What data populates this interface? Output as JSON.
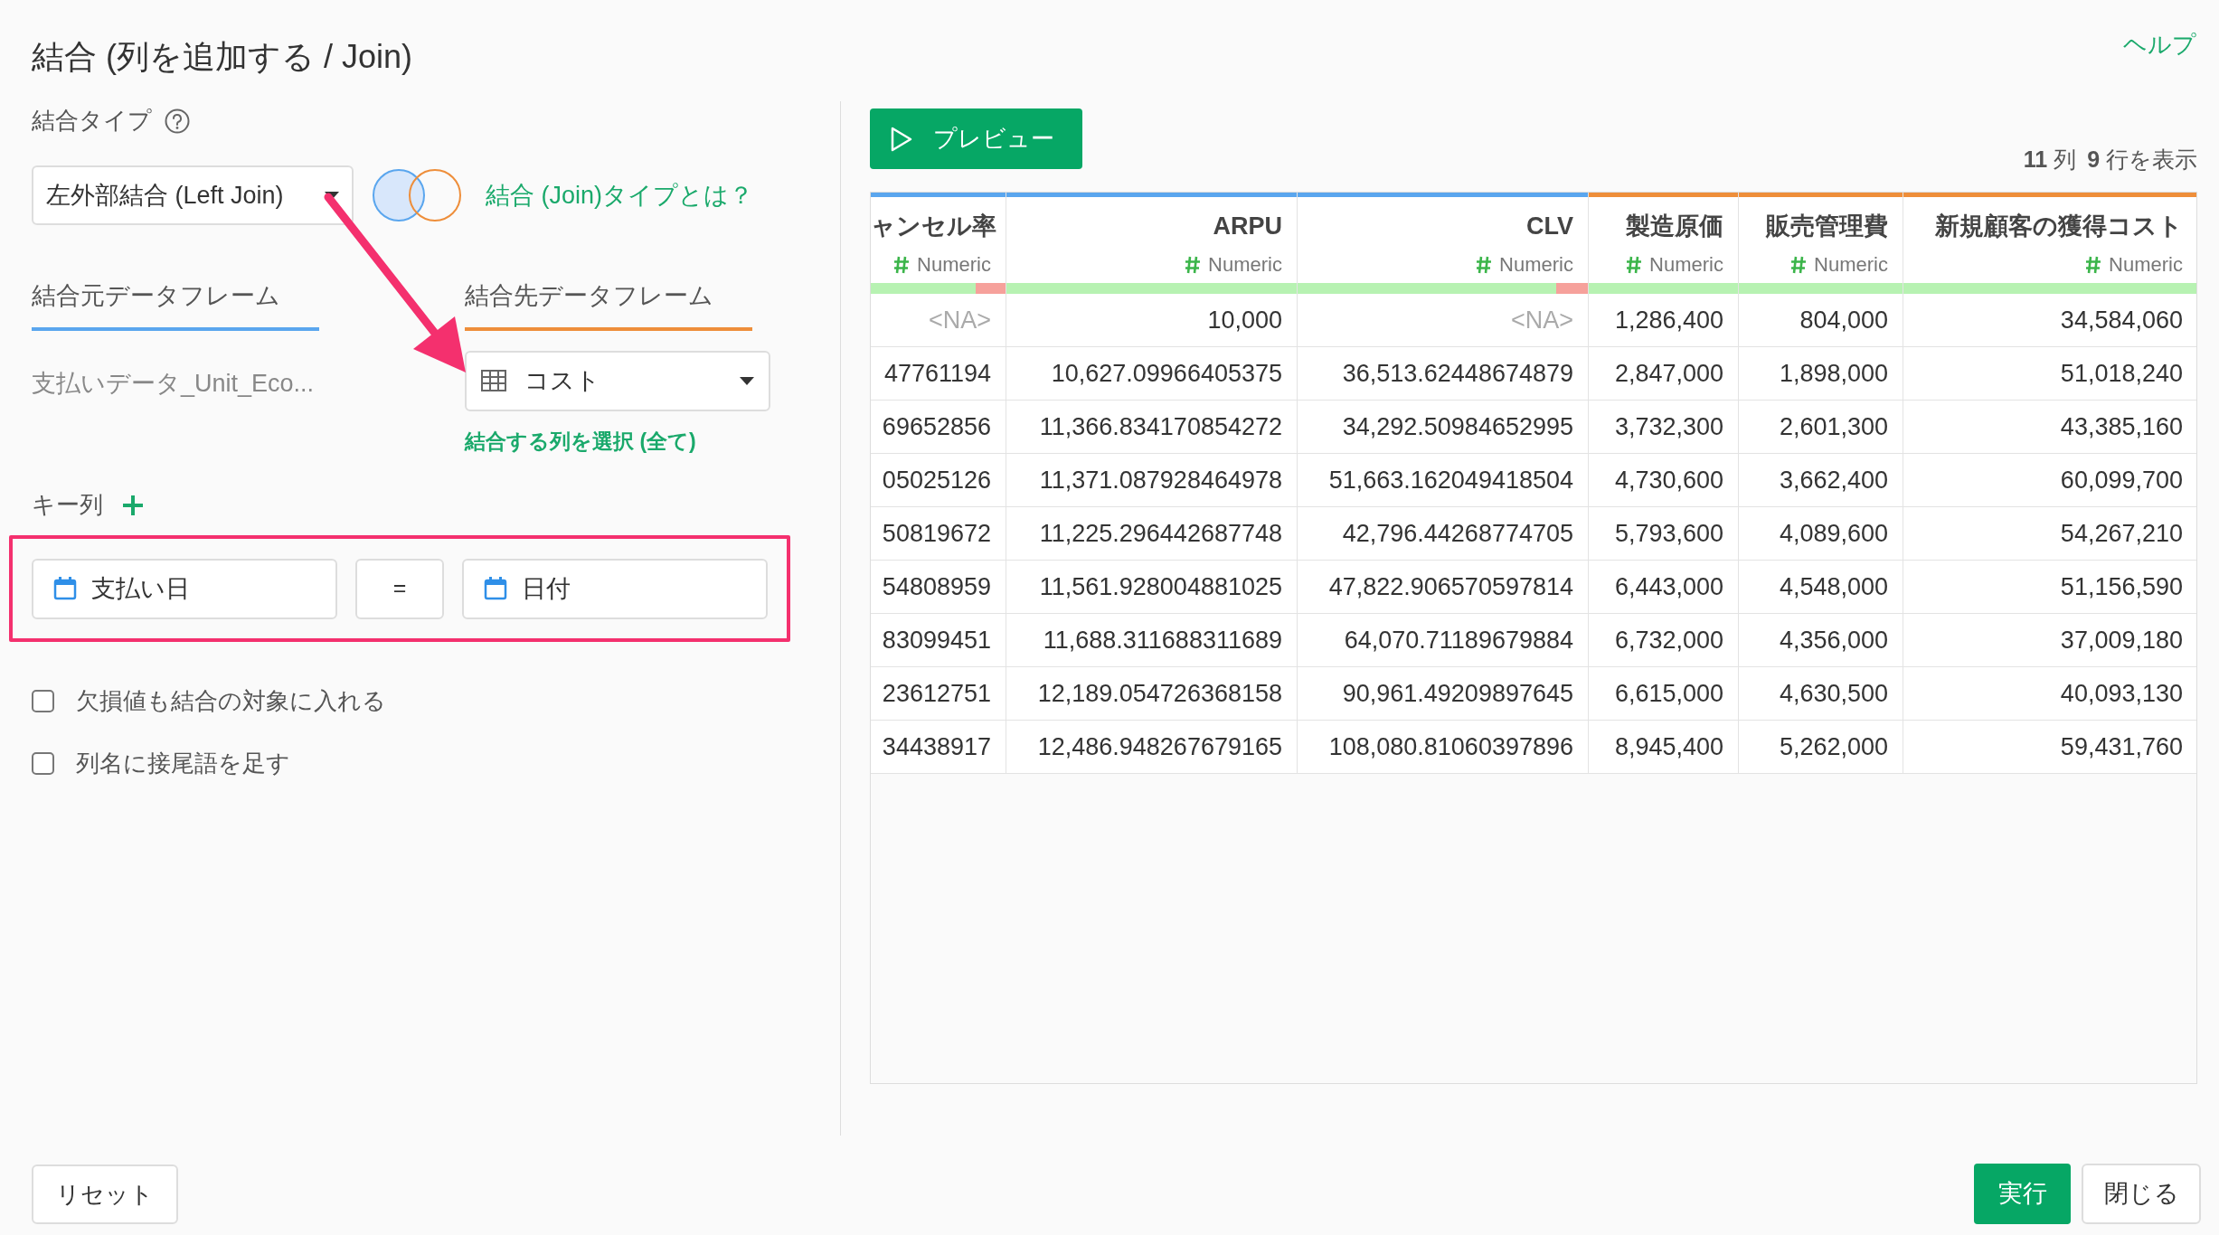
{
  "title": "結合 (列を追加する / Join)",
  "help_link": "ヘルプ",
  "join_type": {
    "label": "結合タイプ",
    "select_value": "左外部結合 (Left Join)",
    "info_link": "結合 (Join)タイプとは？"
  },
  "dataframes": [
    {
      "label": "結合元データフレーム",
      "color": "#5aa6ee",
      "value": "支払いデータ_Unit_Eco..."
    },
    {
      "label": "結合先データフレーム",
      "color": "#ee8e3a",
      "value": "コスト",
      "column_link": "結合する列を選択 (全て)"
    }
  ],
  "key_columns": {
    "label": "キー列",
    "left": "支払い日",
    "operator": "=",
    "right": "日付"
  },
  "options": [
    {
      "label": "欠損値も結合の対象に入れる",
      "checked": false
    },
    {
      "label": "列名に接尾語を足す",
      "checked": false
    }
  ],
  "preview_button": "プレビュー",
  "summary": {
    "columns": "11",
    "columns_unit": "列",
    "rows": "9",
    "rows_unit": "行を表示"
  },
  "table": {
    "columns": [
      {
        "name": "ャンセル率",
        "type": "Numeric",
        "color": "#5aa6ee",
        "level": 0.78
      },
      {
        "name": "ARPU",
        "type": "Numeric",
        "color": "#5aa6ee",
        "level": 1
      },
      {
        "name": "CLV",
        "type": "Numeric",
        "color": "#5aa6ee",
        "level": 0.89
      },
      {
        "name": "製造原価",
        "type": "Numeric",
        "color": "#ee8e3a",
        "level": 1
      },
      {
        "name": "販売管理費",
        "type": "Numeric",
        "color": "#ee8e3a",
        "level": 1
      },
      {
        "name": "新規顧客の獲得コスト",
        "type": "Numeric",
        "color": "#ee8e3a",
        "level": 1
      }
    ],
    "rows": [
      [
        {
          "value": "<NA>",
          "missing": true
        },
        "10,000",
        {
          "value": "<NA>",
          "missing": true
        },
        "1,286,400",
        "804,000",
        "34,584,060"
      ],
      [
        "47761194",
        "10,627.09966405375",
        "36,513.62448674879",
        "2,847,000",
        "1,898,000",
        "51,018,240"
      ],
      [
        "69652856",
        "11,366.834170854272",
        "34,292.50984652995",
        "3,732,300",
        "2,601,300",
        "43,385,160"
      ],
      [
        "05025126",
        "11,371.087928464978",
        "51,663.162049418504",
        "4,730,600",
        "3,662,400",
        "60,099,700"
      ],
      [
        "50819672",
        "11,225.296442687748",
        "42,796.44268774705",
        "5,793,600",
        "4,089,600",
        "54,267,210"
      ],
      [
        "54808959",
        "11,561.928004881025",
        "47,822.906570597814",
        "6,443,000",
        "4,548,000",
        "51,156,590"
      ],
      [
        "83099451",
        "11,688.311688311689",
        "64,070.71189679884",
        "6,732,000",
        "4,356,000",
        "37,009,180"
      ],
      [
        "23612751",
        "12,189.054726368158",
        "90,961.49209897645",
        "6,615,000",
        "4,630,500",
        "40,093,130"
      ],
      [
        "34438917",
        "12,486.948267679165",
        "108,080.81060397896",
        "8,945,400",
        "5,262,000",
        "59,431,760"
      ]
    ]
  },
  "footer": {
    "reset": "リセット",
    "run": "実行",
    "close": "閉じる"
  }
}
